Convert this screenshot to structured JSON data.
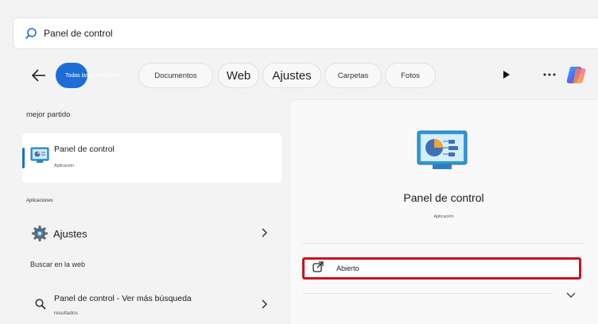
{
  "search": {
    "query": "Panel de control"
  },
  "filters": [
    {
      "label": "Todas las aplicaciones",
      "active": true
    },
    {
      "label": "Documentos"
    },
    {
      "label": "Web"
    },
    {
      "label": "Ajustes"
    },
    {
      "label": "Carpetas"
    },
    {
      "label": "Fotos"
    }
  ],
  "left": {
    "best_match_heading": "mejor partido",
    "best_match": {
      "title": "Panel de control",
      "subtitle": "Aplicación"
    },
    "apps_heading": "Aplicaciones",
    "apps": [
      {
        "label": "Ajustes"
      }
    ],
    "web_heading": "Buscar en la web",
    "web_results": [
      {
        "title": "Panel de control - Ver más búsqueda",
        "subtitle": "resultados"
      }
    ]
  },
  "right": {
    "title": "Panel de control",
    "subtitle": "Aplicación",
    "open_label": "Abierto"
  },
  "colors": {
    "accent": "#1e6dd6",
    "highlight_border": "#c8141e"
  }
}
